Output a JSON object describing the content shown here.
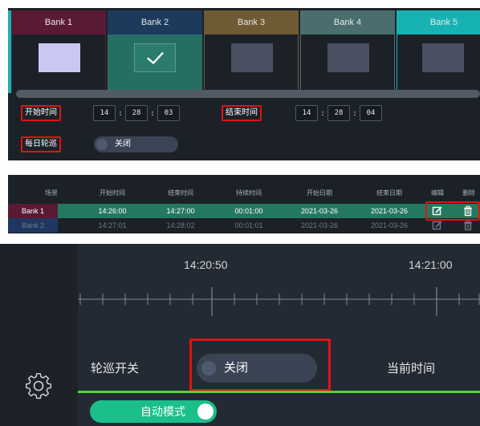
{
  "panel1": {
    "banks": [
      {
        "label": "Bank 1",
        "header_color": "#5a1a33",
        "cell_color": "#1c2128",
        "thumb": "light"
      },
      {
        "label": "Bank 2",
        "header_color": "#1d3a5c",
        "cell_color": "#256e63",
        "thumb": "checked"
      },
      {
        "label": "Bank 3",
        "header_color": "#6e5a33",
        "cell_color": "#1c2128",
        "thumb": "dark"
      },
      {
        "label": "Bank 4",
        "header_color": "#4a6e6e",
        "cell_color": "#1c2128",
        "thumb": "dark"
      },
      {
        "label": "Bank 5",
        "header_color": "#17b3b3",
        "cell_color": "#1c2128",
        "thumb": "dark"
      }
    ],
    "start_time_label": "开始时间",
    "start_time": {
      "h": "14",
      "m": "28",
      "s": "03"
    },
    "end_time_label": "结束时间",
    "end_time": {
      "h": "14",
      "m": "28",
      "s": "04"
    },
    "time_separator": ":",
    "daily_cycle_label": "每日轮巡",
    "daily_cycle_toggle": "关闭"
  },
  "panel2": {
    "headers": [
      "场景",
      "开始时间",
      "结束时间",
      "持续时间",
      "开始日期",
      "结束日期",
      "编辑",
      "删除"
    ],
    "rows": [
      {
        "scene": "Bank 1",
        "start": "14:26:00",
        "end": "14:27:00",
        "duration": "00:01:00",
        "start_date": "2021-03-26",
        "end_date": "2021-03-26",
        "highlight": true
      },
      {
        "scene": "Bank 2",
        "start": "14:27:01",
        "end": "14:28:02",
        "duration": "00:01:01",
        "start_date": "2021-03-26",
        "end_date": "2021-03-26",
        "highlight": false
      }
    ],
    "edit_icon": "edit-icon",
    "delete_icon": "trash-icon"
  },
  "panel3": {
    "timeline_labels": [
      "14:20:50",
      "14:21:00"
    ],
    "cycle_switch_label": "轮巡开关",
    "cycle_switch_toggle": "关闭",
    "current_time_label": "当前时间",
    "auto_mode_label": "自动模式",
    "settings_icon": "gear-icon"
  },
  "colors": {
    "highlight_red": "#e0140f",
    "accent_green": "#4ed23d",
    "toggle_on": "#1bbf8a",
    "row_highlight": "#257860",
    "row_alt": "#1f3760"
  }
}
